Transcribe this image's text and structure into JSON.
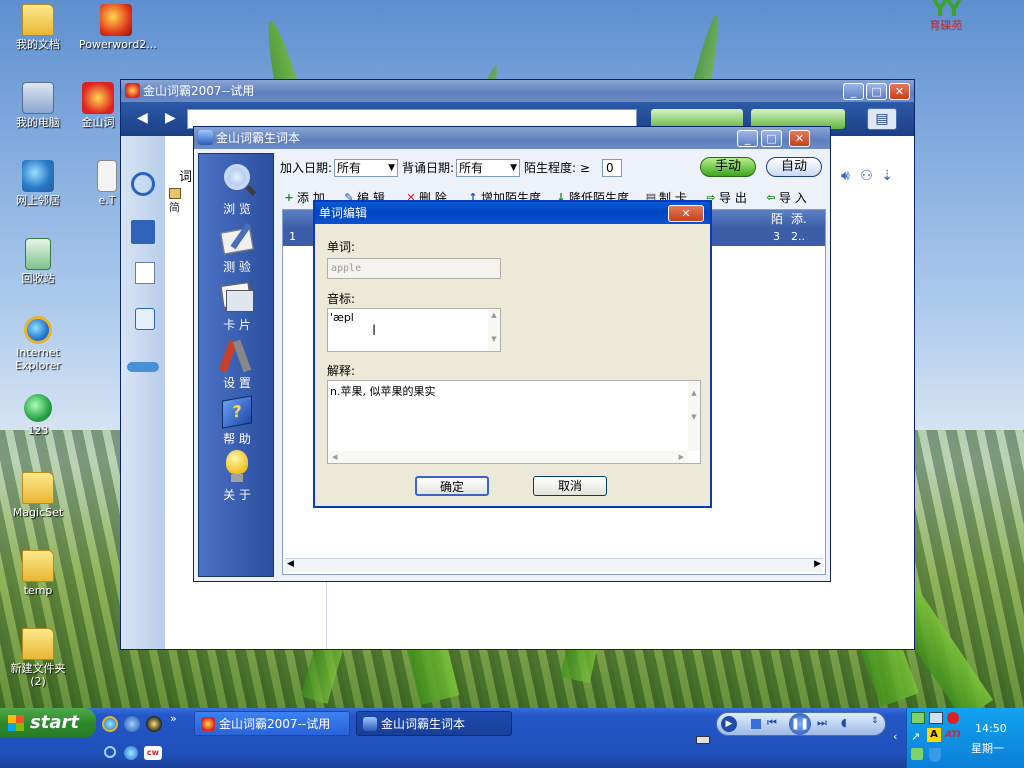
{
  "desktop": {
    "icons": [
      {
        "label": "我的文档",
        "icon": "my-documents-icon"
      },
      {
        "label": "Powerword2...",
        "icon": "powerword-icon"
      },
      {
        "label": "我的电脑",
        "icon": "my-computer-icon"
      },
      {
        "label": "金山词",
        "icon": "kingsoft-shortcut-icon"
      },
      {
        "label": "网上邻居",
        "icon": "network-places-icon"
      },
      {
        "label": "e.T",
        "icon": "file-icon"
      },
      {
        "label": "回收站",
        "icon": "recycle-bin-icon"
      },
      {
        "label": "Internet Explorer",
        "icon": "internet-explorer-icon"
      },
      {
        "label": "123",
        "icon": "shortcut-icon"
      },
      {
        "label": "MagicSet",
        "icon": "folder-icon"
      },
      {
        "label": "temp",
        "icon": "folder-icon"
      },
      {
        "label": "新建文件夹 (2)",
        "icon": "folder-icon"
      }
    ],
    "logo_text": "育碟苑",
    "logo_mark": "YY"
  },
  "main_window": {
    "title": "金山词霸2007--试用",
    "sidebar_fragments": [
      "词",
      "简"
    ]
  },
  "vocab_window": {
    "title": "金山词霸生词本",
    "sidebar": [
      {
        "label": "浏 览",
        "icon": "browse-magnifier-icon"
      },
      {
        "label": "测 验",
        "icon": "test-icon"
      },
      {
        "label": "卡 片",
        "icon": "cards-icon"
      },
      {
        "label": "设 置",
        "icon": "settings-tools-icon"
      },
      {
        "label": "帮 助",
        "icon": "help-book-icon"
      },
      {
        "label": "关 于",
        "icon": "about-bulb-icon"
      }
    ],
    "filter": {
      "add_date_label": "加入日期:",
      "add_date_value": "所有",
      "review_date_label": "背诵日期:",
      "review_date_value": "所有",
      "strangeness_label": "陌生程度: ≥",
      "strangeness_value": "0",
      "manual_label": "手动",
      "auto_label": "自动"
    },
    "toolbar": [
      {
        "label": "添 加",
        "glyph": "+",
        "color": "#1b8a1b"
      },
      {
        "label": "编 辑",
        "glyph": "✎",
        "color": "#1d4fb3"
      },
      {
        "label": "删 除",
        "glyph": "✕",
        "color": "#d01818"
      },
      {
        "label": "增加陌生度",
        "glyph": "↑",
        "color": "#1d4fb3"
      },
      {
        "label": "降低陌生度",
        "glyph": "↓",
        "color": "#1b8a1b"
      },
      {
        "label": "制 卡",
        "glyph": "▤",
        "color": "#333333"
      },
      {
        "label": "导 出",
        "glyph": "⇨",
        "color": "#1b8a1b"
      },
      {
        "label": "导 入",
        "glyph": "⇦",
        "color": "#1b8a1b"
      }
    ],
    "table": {
      "col_strange": "陌",
      "col_added": "添.",
      "row_index": "1",
      "row_strange": "3",
      "row_added": "2.."
    }
  },
  "dialog": {
    "title": "单词编辑",
    "word_label": "单词:",
    "word_value": "apple",
    "phonetic_label": "音标:",
    "phonetic_value": "'æpl",
    "definition_label": "解释:",
    "definition_value": "n.苹果, 似苹果的果实",
    "ok_label": "确定",
    "cancel_label": "取消"
  },
  "taskbar": {
    "start_label": "start",
    "tasks": [
      {
        "label": "金山词霸2007--试用"
      },
      {
        "label": "金山词霸生词本"
      }
    ],
    "clock_time": "14:50",
    "clock_day": "星期一"
  }
}
